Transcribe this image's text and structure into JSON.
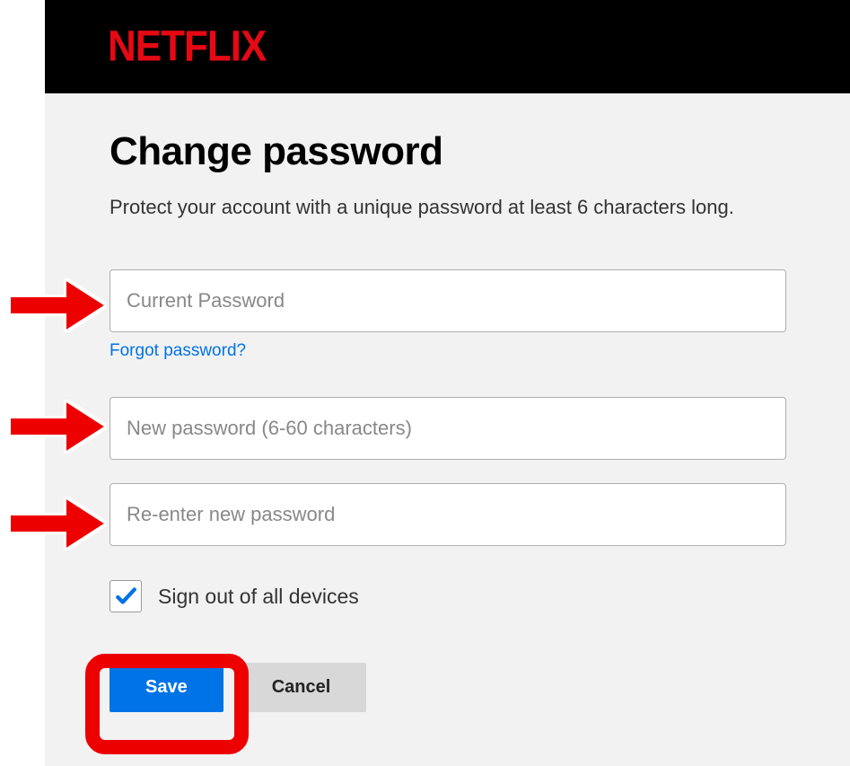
{
  "brand": "NETFLIX",
  "page": {
    "title": "Change password",
    "subtitle": "Protect your account with a unique password at least 6 characters long."
  },
  "form": {
    "currentPassword": {
      "placeholder": "Current Password",
      "value": ""
    },
    "forgotLink": "Forgot password?",
    "newPassword": {
      "placeholder": "New password (6-60 characters)",
      "value": ""
    },
    "confirmPassword": {
      "placeholder": "Re-enter new password",
      "value": ""
    },
    "signOutAll": {
      "label": "Sign out of all devices",
      "checked": true
    }
  },
  "buttons": {
    "save": "Save",
    "cancel": "Cancel"
  },
  "colors": {
    "brand": "#e50914",
    "link": "#0073e6",
    "primaryButton": "#0073e6",
    "annotation": "#ed0000"
  }
}
